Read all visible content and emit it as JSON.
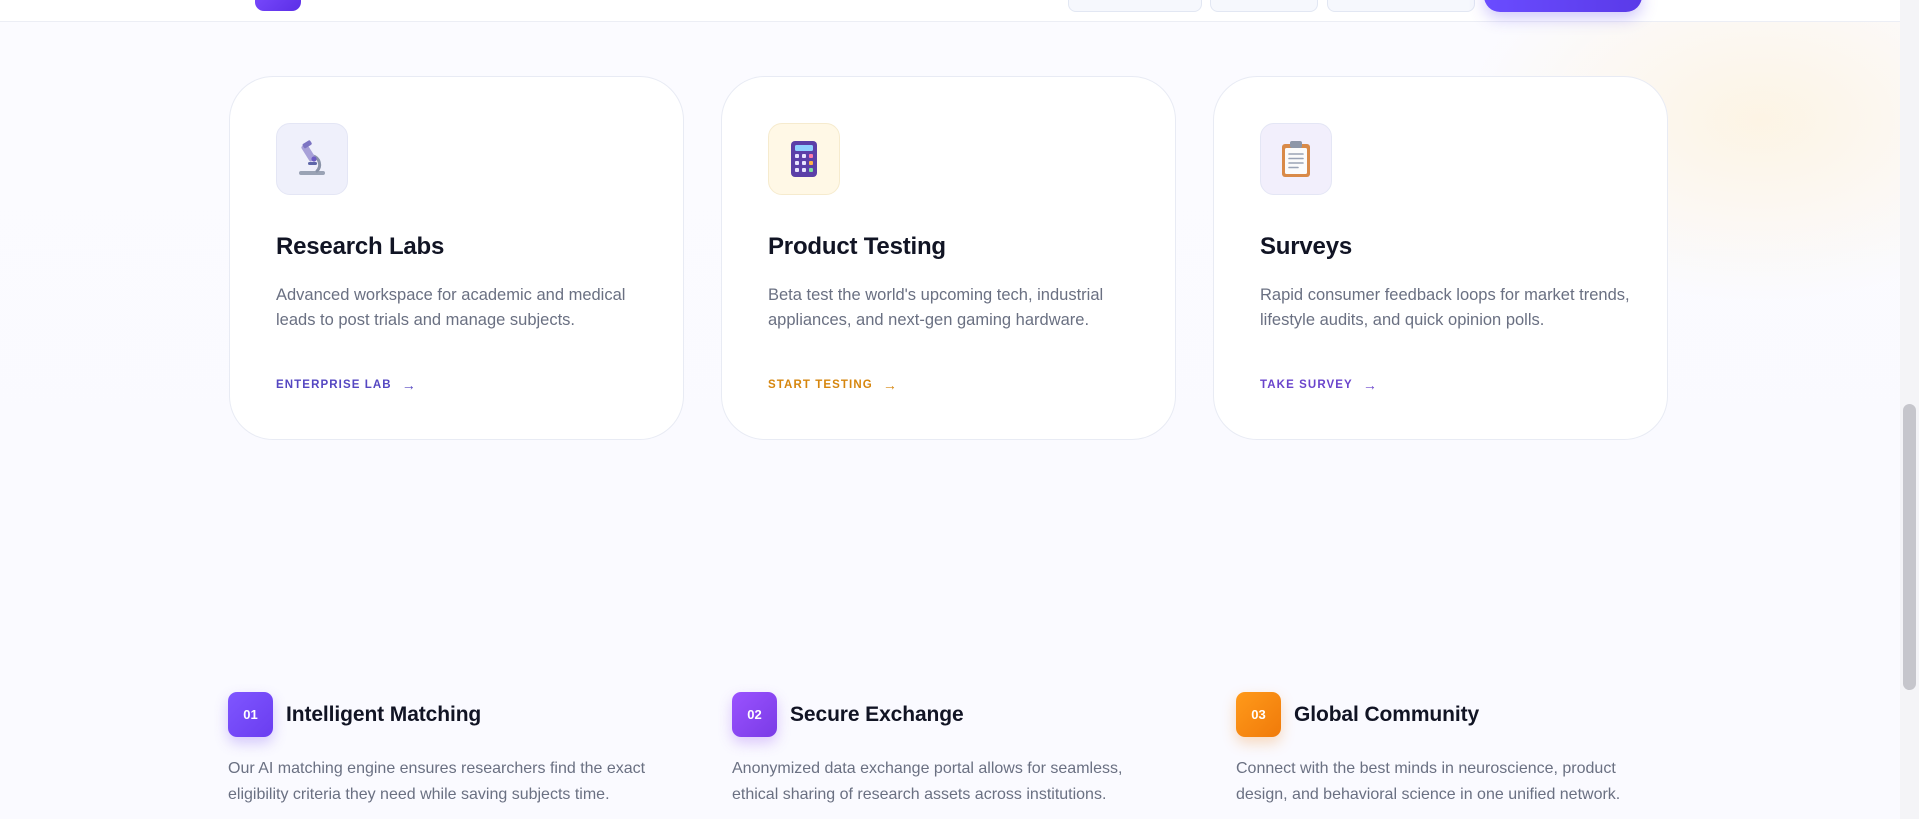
{
  "colors": {
    "primary": "#6a4cff",
    "amber": "#d6860e",
    "violet": "#6a44cc",
    "indigo": "#5547c2",
    "orange": "#f07a0a"
  },
  "cards": [
    {
      "icon": "microscope-icon",
      "title": "Research Labs",
      "description": "Advanced workspace for academic and medical leads to post trials and manage subjects.",
      "link_label": "Enterprise Lab",
      "arrow": "→"
    },
    {
      "icon": "calculator-icon",
      "title": "Product Testing",
      "description": "Beta test the world's upcoming tech, industrial appliances, and next-gen gaming hardware.",
      "link_label": "Start Testing",
      "arrow": "→"
    },
    {
      "icon": "clipboard-icon",
      "title": "Surveys",
      "description": "Rapid consumer feedback loops for market trends, lifestyle audits, and quick opinion polls.",
      "link_label": "Take Survey",
      "arrow": "→"
    }
  ],
  "features": [
    {
      "number": "01",
      "title": "Intelligent Matching",
      "description": "Our AI matching engine ensures researchers find the exact eligibility criteria they need while saving subjects time."
    },
    {
      "number": "02",
      "title": "Secure Exchange",
      "description": "Anonymized data exchange portal allows for seamless, ethical sharing of research assets across institutions."
    },
    {
      "number": "03",
      "title": "Global Community",
      "description": "Connect with the best minds in neuroscience, product design, and behavioral science in one unified network."
    }
  ]
}
